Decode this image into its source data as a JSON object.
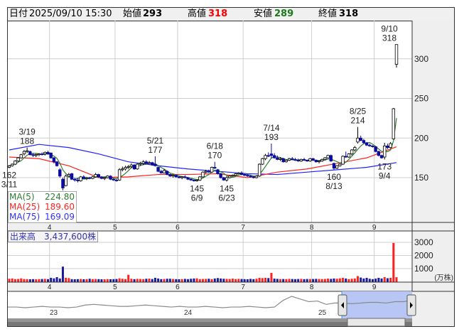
{
  "header": {
    "date_label": "日付",
    "datetime": "2025/09/10 15:30",
    "open_label": "始値",
    "open": "293",
    "high_label": "高値",
    "high": "318",
    "low_label": "安値",
    "low": "289",
    "close_label": "終値",
    "close": "318"
  },
  "legend": [
    {
      "label": "MA(5)",
      "value": "224.80",
      "color": "#2e7d32"
    },
    {
      "label": "MA(25)",
      "value": "189.60",
      "color": "#ff2020"
    },
    {
      "label": "MA(75)",
      "value": "169.09",
      "color": "#3030ff"
    }
  ],
  "volume_label": "出来高　3,437,600株",
  "volume_unit": "(万株)",
  "colors": {
    "up_volume": "#ff2020",
    "down_volume": "#1a1a9a",
    "flat_volume": "#8c8c8c",
    "down_candle": "#0c0ca0",
    "ma5": "#2e7d32",
    "ma25": "#ff2020",
    "ma75": "#2020ff",
    "nav_fill": "#b8c6f5"
  },
  "chart_data": {
    "type": "candlestick",
    "price_axis": {
      "ticks": [
        "150",
        "200",
        "250",
        "300"
      ],
      "tick_values": [
        150,
        200,
        250,
        300
      ]
    },
    "month_ticks": [
      {
        "label": "4",
        "index": 14
      },
      {
        "label": "5",
        "index": 36
      },
      {
        "label": "6",
        "index": 57
      },
      {
        "label": "7",
        "index": 79
      },
      {
        "label": "8",
        "index": 102
      },
      {
        "label": "9",
        "index": 123
      }
    ],
    "volume_axis": {
      "ticks": [
        "1000",
        "2000",
        "3000"
      ],
      "tick_values": [
        1000,
        2000,
        3000
      ],
      "unit": "万株"
    },
    "ohlc": [
      [
        163,
        166,
        162,
        165
      ],
      [
        165,
        168,
        164,
        167
      ],
      [
        167,
        172,
        166,
        171
      ],
      [
        171,
        176,
        170,
        175
      ],
      [
        175,
        180,
        174,
        179
      ],
      [
        180,
        185,
        178,
        183
      ],
      [
        183,
        188,
        181,
        184
      ],
      [
        183,
        184,
        178,
        179
      ],
      [
        179,
        181,
        176,
        178
      ],
      [
        178,
        180,
        176,
        179
      ],
      [
        179,
        181,
        177,
        180
      ],
      [
        180,
        182,
        178,
        179
      ],
      [
        180,
        183,
        178,
        182
      ],
      [
        182,
        184,
        179,
        180
      ],
      [
        181,
        182,
        174,
        175
      ],
      [
        175,
        176,
        168,
        170
      ],
      [
        170,
        171,
        164,
        165
      ],
      [
        160,
        162,
        150,
        152
      ],
      [
        148,
        150,
        134,
        137
      ],
      [
        140,
        154,
        139,
        152
      ],
      [
        152,
        156,
        150,
        154
      ],
      [
        155,
        156,
        147,
        148
      ],
      [
        148,
        150,
        145,
        147
      ],
      [
        147,
        149,
        144,
        146
      ],
      [
        146,
        152,
        145,
        151
      ],
      [
        151,
        153,
        148,
        149
      ],
      [
        149,
        151,
        147,
        150
      ],
      [
        150,
        151,
        148,
        149
      ],
      [
        149,
        152,
        148,
        151
      ],
      [
        151,
        156,
        150,
        154
      ],
      [
        154,
        155,
        150,
        151
      ],
      [
        151,
        152,
        148,
        149
      ],
      [
        149,
        151,
        147,
        150
      ],
      [
        150,
        153,
        149,
        152
      ],
      [
        152,
        153,
        147,
        148
      ],
      [
        148,
        149,
        146,
        147
      ],
      [
        147,
        148,
        145,
        146
      ],
      [
        147,
        162,
        146,
        160
      ],
      [
        160,
        164,
        158,
        161
      ],
      [
        161,
        165,
        159,
        163
      ],
      [
        163,
        166,
        161,
        164
      ],
      [
        164,
        168,
        162,
        166
      ],
      [
        166,
        167,
        160,
        161
      ],
      [
        161,
        168,
        160,
        167
      ],
      [
        167,
        170,
        165,
        168
      ],
      [
        168,
        172,
        166,
        170
      ],
      [
        170,
        172,
        167,
        168
      ],
      [
        168,
        171,
        167,
        169
      ],
      [
        169,
        170,
        165,
        166
      ],
      [
        167,
        177,
        164,
        165
      ],
      [
        163,
        164,
        157,
        158
      ],
      [
        158,
        160,
        155,
        156
      ],
      [
        156,
        161,
        155,
        159
      ],
      [
        158,
        159,
        153,
        154
      ],
      [
        154,
        155,
        151,
        152
      ],
      [
        152,
        154,
        150,
        153
      ],
      [
        153,
        154,
        150,
        151
      ],
      [
        151,
        152,
        149,
        150
      ],
      [
        150,
        152,
        148,
        151
      ],
      [
        151,
        153,
        149,
        150
      ],
      [
        150,
        151,
        147,
        148
      ],
      [
        148,
        149,
        146,
        147
      ],
      [
        147,
        148,
        145,
        146
      ],
      [
        146,
        148,
        145,
        147
      ],
      [
        147,
        152,
        146,
        151
      ],
      [
        151,
        158,
        150,
        157
      ],
      [
        157,
        160,
        155,
        158
      ],
      [
        158,
        160,
        156,
        157
      ],
      [
        157,
        164,
        156,
        163
      ],
      [
        163,
        170,
        161,
        162
      ],
      [
        160,
        161,
        154,
        155
      ],
      [
        155,
        156,
        149,
        150
      ],
      [
        150,
        151,
        146,
        147
      ],
      [
        147,
        152,
        145,
        150
      ],
      [
        150,
        153,
        149,
        152
      ],
      [
        152,
        154,
        151,
        153
      ],
      [
        153,
        156,
        152,
        155
      ],
      [
        155,
        157,
        154,
        156
      ],
      [
        156,
        158,
        153,
        154
      ],
      [
        154,
        155,
        152,
        153
      ],
      [
        153,
        154,
        151,
        152
      ],
      [
        152,
        153,
        150,
        151
      ],
      [
        151,
        152,
        149,
        150
      ],
      [
        150,
        153,
        149,
        152
      ],
      [
        152,
        168,
        151,
        167
      ],
      [
        167,
        175,
        166,
        174
      ],
      [
        174,
        180,
        172,
        178
      ],
      [
        178,
        182,
        176,
        177
      ],
      [
        180,
        193,
        174,
        178
      ],
      [
        178,
        181,
        174,
        175
      ],
      [
        175,
        178,
        172,
        173
      ],
      [
        173,
        176,
        171,
        174
      ],
      [
        174,
        175,
        169,
        170
      ],
      [
        170,
        173,
        169,
        172
      ],
      [
        172,
        175,
        171,
        174
      ],
      [
        174,
        176,
        172,
        173
      ],
      [
        173,
        175,
        171,
        172
      ],
      [
        172,
        174,
        170,
        171
      ],
      [
        171,
        174,
        170,
        173
      ],
      [
        173,
        175,
        171,
        172
      ],
      [
        172,
        173,
        170,
        171
      ],
      [
        171,
        175,
        170,
        174
      ],
      [
        174,
        175,
        171,
        172
      ],
      [
        172,
        173,
        169,
        170
      ],
      [
        170,
        172,
        168,
        171
      ],
      [
        171,
        174,
        170,
        173
      ],
      [
        173,
        176,
        172,
        175
      ],
      [
        175,
        179,
        174,
        178
      ],
      [
        178,
        179,
        170,
        171
      ],
      [
        168,
        169,
        160,
        162
      ],
      [
        162,
        166,
        161,
        165
      ],
      [
        165,
        168,
        164,
        167
      ],
      [
        167,
        178,
        166,
        177
      ],
      [
        177,
        183,
        175,
        176
      ],
      [
        176,
        181,
        175,
        180
      ],
      [
        180,
        186,
        178,
        185
      ],
      [
        185,
        190,
        183,
        188
      ],
      [
        195,
        214,
        193,
        200
      ],
      [
        200,
        203,
        196,
        197
      ],
      [
        197,
        199,
        193,
        194
      ],
      [
        194,
        195,
        190,
        191
      ],
      [
        191,
        193,
        189,
        190
      ],
      [
        190,
        191,
        188,
        189
      ],
      [
        189,
        190,
        182,
        183
      ],
      [
        183,
        184,
        177,
        178
      ],
      [
        178,
        179,
        174,
        175
      ],
      [
        176,
        194,
        173,
        190
      ],
      [
        190,
        193,
        186,
        188
      ],
      [
        188,
        195,
        187,
        193
      ],
      [
        199,
        238,
        198,
        237
      ],
      [
        293,
        318,
        289,
        318
      ]
    ],
    "volume": [
      230,
      250,
      200,
      210,
      260,
      210,
      200,
      190,
      200,
      190,
      200,
      210,
      220,
      200,
      300,
      260,
      350,
      250,
      1150,
      300,
      280,
      200,
      190,
      200,
      210,
      190,
      200,
      230,
      200,
      210,
      200,
      190,
      190,
      200,
      190,
      200,
      210,
      260,
      230,
      200,
      530,
      230,
      200,
      220,
      210,
      200,
      230,
      240,
      210,
      300,
      250,
      200,
      210,
      230,
      230,
      210,
      200,
      190,
      200,
      220,
      200,
      230,
      250,
      260,
      200,
      210,
      220,
      230,
      200,
      250,
      280,
      250,
      230,
      220,
      210,
      240,
      200,
      220,
      210,
      200,
      190,
      220,
      200,
      230,
      300,
      280,
      300,
      280,
      680,
      240,
      220,
      200,
      210,
      200,
      220,
      210,
      200,
      210,
      220,
      200,
      210,
      200,
      210,
      220,
      210,
      200,
      210,
      240,
      220,
      250,
      230,
      260,
      300,
      250,
      200,
      230,
      250,
      430,
      320,
      250,
      300,
      230,
      200,
      240,
      300,
      250,
      350,
      270,
      300,
      2950,
      344
    ],
    "ma25_sampled_every_10": [
      176,
      174,
      165,
      150,
      151,
      154,
      154,
      155,
      150,
      157,
      161,
      168,
      175,
      189
    ],
    "ma75_sampled_every_10": [
      185,
      192,
      188,
      180,
      170,
      165,
      161,
      158,
      155,
      154,
      157,
      160,
      163,
      169
    ],
    "annotations": [
      {
        "index": 0,
        "date": "3/11",
        "value": "162",
        "pos": "below"
      },
      {
        "index": 6,
        "date": "3/19",
        "value": "188",
        "pos": "above"
      },
      {
        "index": 49,
        "date": "5/21",
        "value": "177",
        "pos": "above"
      },
      {
        "index": 63,
        "date": "6/9",
        "value": "145",
        "pos": "below"
      },
      {
        "index": 69,
        "date": "6/18",
        "value": "170",
        "pos": "above"
      },
      {
        "index": 73,
        "date": "6/23",
        "value": "145",
        "pos": "below"
      },
      {
        "index": 88,
        "date": "7/14",
        "value": "193",
        "pos": "above"
      },
      {
        "index": 109,
        "date": "8/13",
        "value": "160",
        "pos": "below"
      },
      {
        "index": 117,
        "date": "8/25",
        "value": "214",
        "pos": "above"
      },
      {
        "index": 126,
        "date": "9/4",
        "value": "173",
        "pos": "below"
      },
      {
        "index": 130,
        "date": "9/10",
        "value": "318",
        "pos": "above"
      }
    ]
  },
  "navigator": {
    "year_labels": [
      "23",
      "24",
      "25"
    ],
    "series": [
      100,
      100,
      99,
      100,
      101,
      100,
      100,
      99,
      100,
      103,
      104,
      103,
      102,
      101,
      101,
      102,
      103,
      102,
      101,
      100,
      101,
      100,
      100,
      101,
      100,
      99,
      100,
      100,
      101,
      100,
      99,
      100,
      110,
      116,
      112,
      108,
      109,
      104,
      106,
      106,
      105,
      106,
      107,
      107,
      106,
      108,
      108,
      110
    ]
  }
}
